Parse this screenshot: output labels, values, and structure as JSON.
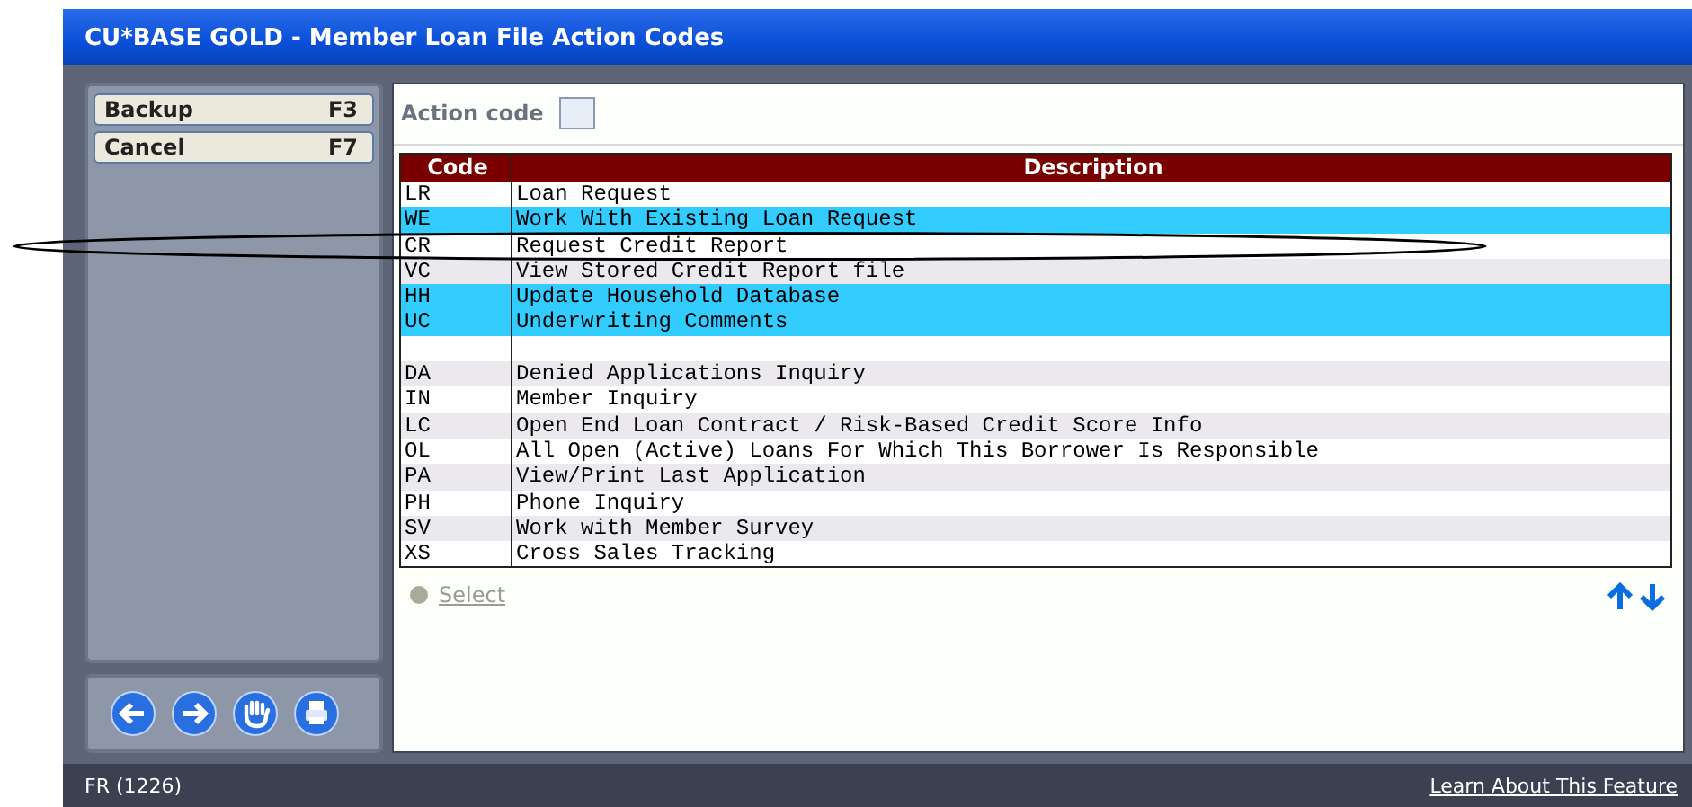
{
  "window": {
    "title": "CU*BASE GOLD - Member Loan File Action Codes"
  },
  "sidebar": {
    "buttons": [
      {
        "label": "Backup",
        "key": "F3"
      },
      {
        "label": "Cancel",
        "key": "F7"
      }
    ]
  },
  "action_code": {
    "label": "Action code"
  },
  "table": {
    "columns": [
      "Code",
      "Description"
    ],
    "rows": [
      {
        "kind": "item",
        "code": "LR",
        "description": "Loan Request",
        "highlighted": false
      },
      {
        "kind": "item",
        "code": "WE",
        "description": "Work With Existing Loan Request",
        "highlighted": true
      },
      {
        "kind": "item",
        "code": "CR",
        "description": "Request Credit Report",
        "highlighted": false
      },
      {
        "kind": "item",
        "code": "VC",
        "description": "View Stored Credit Report file",
        "highlighted": false
      },
      {
        "kind": "item",
        "code": "HH",
        "description": "Update Household Database",
        "highlighted": true
      },
      {
        "kind": "item",
        "code": "UC",
        "description": "Underwriting Comments",
        "highlighted": true
      },
      {
        "kind": "spacer"
      },
      {
        "kind": "item",
        "code": "DA",
        "description": "Denied Applications Inquiry",
        "highlighted": false
      },
      {
        "kind": "item",
        "code": "IN",
        "description": "Member Inquiry",
        "highlighted": false
      },
      {
        "kind": "item",
        "code": "LC",
        "description": "Open End Loan Contract / Risk-Based Credit Score Info",
        "highlighted": false
      },
      {
        "kind": "item",
        "code": "OL",
        "description": "All Open (Active) Loans For Which This Borrower Is Responsible",
        "highlighted": false
      },
      {
        "kind": "item",
        "code": "PA",
        "description": "View/Print Last Application",
        "highlighted": false
      },
      {
        "kind": "item",
        "code": "PH",
        "description": "Phone Inquiry",
        "highlighted": false
      },
      {
        "kind": "item",
        "code": "SV",
        "description": "Work with Member Survey",
        "highlighted": false
      },
      {
        "kind": "item",
        "code": "XS",
        "description": "Cross Sales Tracking",
        "highlighted": false
      }
    ]
  },
  "select": {
    "label": "Select",
    "disabled": true
  },
  "status_bar": {
    "left": "FR (1226)",
    "link": "Learn About This Feature"
  }
}
